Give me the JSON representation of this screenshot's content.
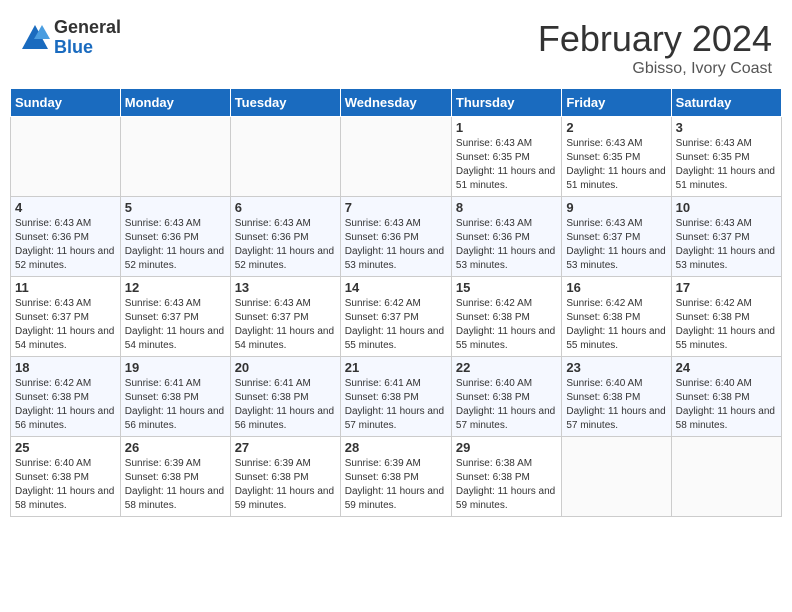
{
  "logo": {
    "general": "General",
    "blue": "Blue"
  },
  "title": "February 2024",
  "location": "Gbisso, Ivory Coast",
  "days_of_week": [
    "Sunday",
    "Monday",
    "Tuesday",
    "Wednesday",
    "Thursday",
    "Friday",
    "Saturday"
  ],
  "weeks": [
    [
      {
        "day": "",
        "info": ""
      },
      {
        "day": "",
        "info": ""
      },
      {
        "day": "",
        "info": ""
      },
      {
        "day": "",
        "info": ""
      },
      {
        "day": "1",
        "info": "Sunrise: 6:43 AM\nSunset: 6:35 PM\nDaylight: 11 hours and 51 minutes."
      },
      {
        "day": "2",
        "info": "Sunrise: 6:43 AM\nSunset: 6:35 PM\nDaylight: 11 hours and 51 minutes."
      },
      {
        "day": "3",
        "info": "Sunrise: 6:43 AM\nSunset: 6:35 PM\nDaylight: 11 hours and 51 minutes."
      }
    ],
    [
      {
        "day": "4",
        "info": "Sunrise: 6:43 AM\nSunset: 6:36 PM\nDaylight: 11 hours and 52 minutes."
      },
      {
        "day": "5",
        "info": "Sunrise: 6:43 AM\nSunset: 6:36 PM\nDaylight: 11 hours and 52 minutes."
      },
      {
        "day": "6",
        "info": "Sunrise: 6:43 AM\nSunset: 6:36 PM\nDaylight: 11 hours and 52 minutes."
      },
      {
        "day": "7",
        "info": "Sunrise: 6:43 AM\nSunset: 6:36 PM\nDaylight: 11 hours and 53 minutes."
      },
      {
        "day": "8",
        "info": "Sunrise: 6:43 AM\nSunset: 6:36 PM\nDaylight: 11 hours and 53 minutes."
      },
      {
        "day": "9",
        "info": "Sunrise: 6:43 AM\nSunset: 6:37 PM\nDaylight: 11 hours and 53 minutes."
      },
      {
        "day": "10",
        "info": "Sunrise: 6:43 AM\nSunset: 6:37 PM\nDaylight: 11 hours and 53 minutes."
      }
    ],
    [
      {
        "day": "11",
        "info": "Sunrise: 6:43 AM\nSunset: 6:37 PM\nDaylight: 11 hours and 54 minutes."
      },
      {
        "day": "12",
        "info": "Sunrise: 6:43 AM\nSunset: 6:37 PM\nDaylight: 11 hours and 54 minutes."
      },
      {
        "day": "13",
        "info": "Sunrise: 6:43 AM\nSunset: 6:37 PM\nDaylight: 11 hours and 54 minutes."
      },
      {
        "day": "14",
        "info": "Sunrise: 6:42 AM\nSunset: 6:37 PM\nDaylight: 11 hours and 55 minutes."
      },
      {
        "day": "15",
        "info": "Sunrise: 6:42 AM\nSunset: 6:38 PM\nDaylight: 11 hours and 55 minutes."
      },
      {
        "day": "16",
        "info": "Sunrise: 6:42 AM\nSunset: 6:38 PM\nDaylight: 11 hours and 55 minutes."
      },
      {
        "day": "17",
        "info": "Sunrise: 6:42 AM\nSunset: 6:38 PM\nDaylight: 11 hours and 55 minutes."
      }
    ],
    [
      {
        "day": "18",
        "info": "Sunrise: 6:42 AM\nSunset: 6:38 PM\nDaylight: 11 hours and 56 minutes."
      },
      {
        "day": "19",
        "info": "Sunrise: 6:41 AM\nSunset: 6:38 PM\nDaylight: 11 hours and 56 minutes."
      },
      {
        "day": "20",
        "info": "Sunrise: 6:41 AM\nSunset: 6:38 PM\nDaylight: 11 hours and 56 minutes."
      },
      {
        "day": "21",
        "info": "Sunrise: 6:41 AM\nSunset: 6:38 PM\nDaylight: 11 hours and 57 minutes."
      },
      {
        "day": "22",
        "info": "Sunrise: 6:40 AM\nSunset: 6:38 PM\nDaylight: 11 hours and 57 minutes."
      },
      {
        "day": "23",
        "info": "Sunrise: 6:40 AM\nSunset: 6:38 PM\nDaylight: 11 hours and 57 minutes."
      },
      {
        "day": "24",
        "info": "Sunrise: 6:40 AM\nSunset: 6:38 PM\nDaylight: 11 hours and 58 minutes."
      }
    ],
    [
      {
        "day": "25",
        "info": "Sunrise: 6:40 AM\nSunset: 6:38 PM\nDaylight: 11 hours and 58 minutes."
      },
      {
        "day": "26",
        "info": "Sunrise: 6:39 AM\nSunset: 6:38 PM\nDaylight: 11 hours and 58 minutes."
      },
      {
        "day": "27",
        "info": "Sunrise: 6:39 AM\nSunset: 6:38 PM\nDaylight: 11 hours and 59 minutes."
      },
      {
        "day": "28",
        "info": "Sunrise: 6:39 AM\nSunset: 6:38 PM\nDaylight: 11 hours and 59 minutes."
      },
      {
        "day": "29",
        "info": "Sunrise: 6:38 AM\nSunset: 6:38 PM\nDaylight: 11 hours and 59 minutes."
      },
      {
        "day": "",
        "info": ""
      },
      {
        "day": "",
        "info": ""
      }
    ]
  ]
}
